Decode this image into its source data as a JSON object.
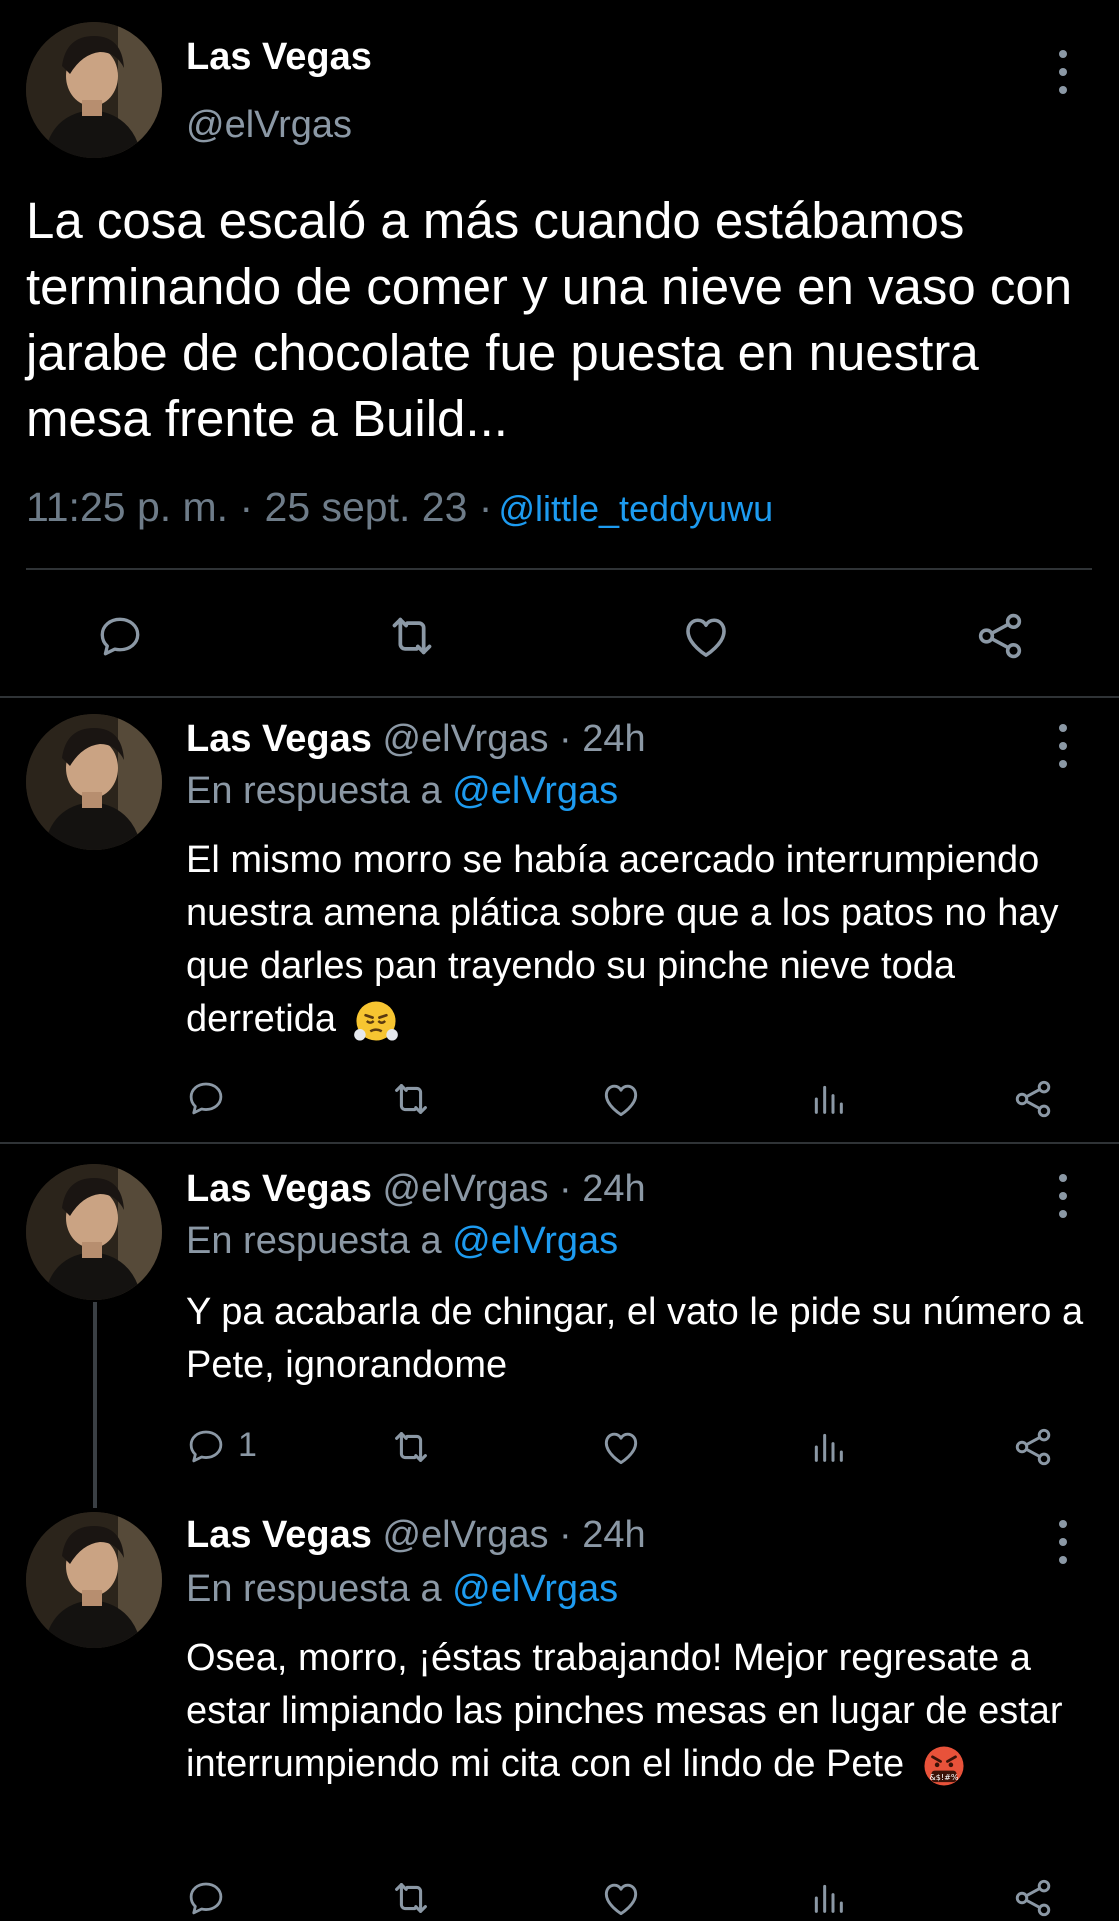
{
  "main_tweet": {
    "display_name": "Las Vegas",
    "handle": "@elVrgas",
    "text": "La cosa escaló a más cuando estábamos terminando de comer y una nieve en vaso con jarabe de chocolate fue puesta en nuestra mesa frente a Build...",
    "timestamp": "11:25 p. m. · 25 sept. 23 ·",
    "via": "@little_teddyuwu",
    "actions": [
      "reply-icon",
      "retweet-icon",
      "like-icon",
      "share-icon"
    ]
  },
  "replies": [
    {
      "display_name": "Las Vegas",
      "handle_time": "@elVrgas · 24h",
      "in_reply_prefix": "En respuesta a",
      "in_reply_to": "@elVrgas",
      "text": "El mismo morro se había acercado interrumpiendo nuestra amena plática sobre que a los patos no hay que darles pan trayendo su pinche nieve toda derretida",
      "emoji": "face-with-steam-emoji",
      "reply_count": ""
    },
    {
      "display_name": "Las Vegas",
      "handle_time": "@elVrgas · 24h",
      "in_reply_prefix": "En respuesta a",
      "in_reply_to": "@elVrgas",
      "text": "Y pa acabarla de chingar, el vato le pide su número a Pete, ignorandome",
      "emoji": "",
      "reply_count": "1"
    },
    {
      "display_name": "Las Vegas",
      "handle_time": "@elVrgas · 24h",
      "in_reply_prefix": "En respuesta a",
      "in_reply_to": "@elVrgas",
      "text": "Osea, morro, ¡éstas trabajando! Mejor regresate a estar limpiando las pinches mesas en lugar de estar interrumpiendo mi cita con el lindo de Pete",
      "emoji": "face-with-symbols-emoji",
      "reply_count": ""
    }
  ],
  "colors": {
    "background": "#000000",
    "text": "#ffffff",
    "secondary": "#8b98a5",
    "link": "#1d9bf0",
    "divider": "#2f3336"
  }
}
